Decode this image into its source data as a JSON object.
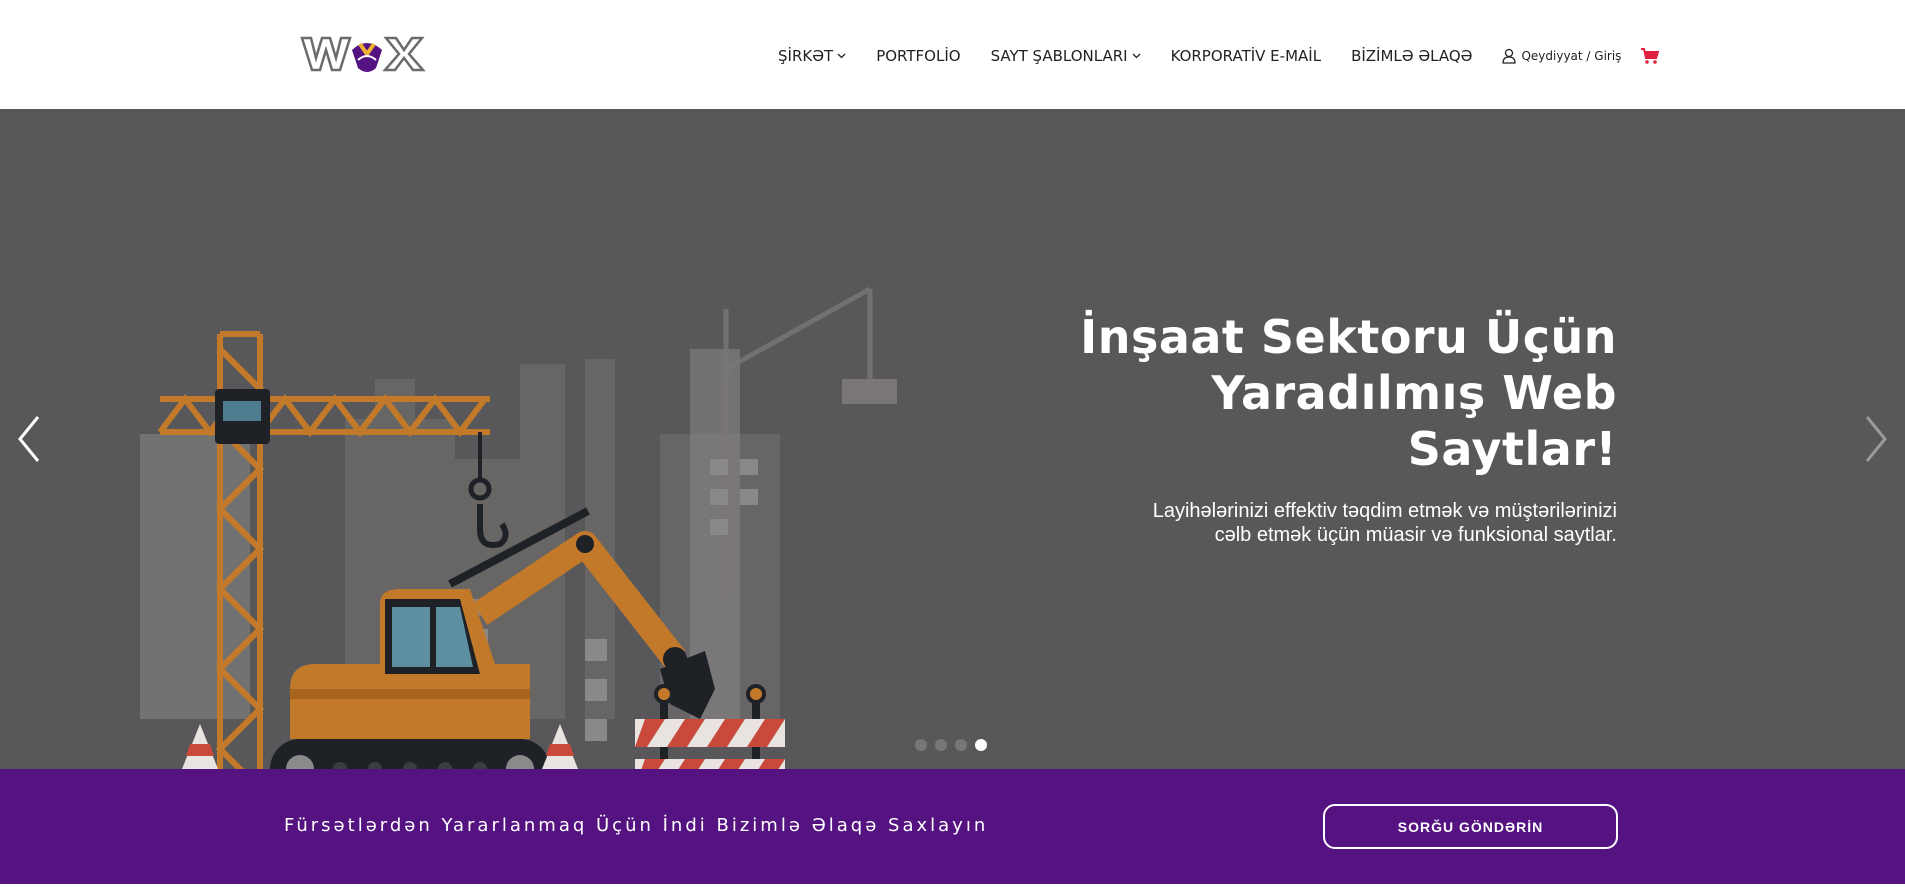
{
  "brand": {
    "logo_text": "WOX",
    "colors": {
      "purple": "#551382",
      "gray": "#58585a",
      "accent_red": "#e02040",
      "crane_orange": "#c27a2a"
    }
  },
  "nav": {
    "items": [
      {
        "label": "ŞİRKƏT",
        "has_dropdown": true
      },
      {
        "label": "PORTFOLİO",
        "has_dropdown": false
      },
      {
        "label": "SAYT ŞABLONLARI",
        "has_dropdown": true
      },
      {
        "label": "KORPORATİV E-MAİL",
        "has_dropdown": false
      },
      {
        "label": "BİZİMLƏ ƏLAQƏ",
        "has_dropdown": false
      }
    ],
    "login_label": "Qeydiyyat / Giriş",
    "login_icon": "user-icon",
    "cart_icon": "cart-icon"
  },
  "hero": {
    "title_lines": [
      "İnşaat Sektoru Üçün",
      "Yaradılmış Web",
      "Saytlar!"
    ],
    "subtitle_lines": [
      "Layihələrinizi effektiv təqdim etmək və müştərilərinizi",
      "cəlb etmək üçün müasir və funksional saytlar."
    ],
    "prev_icon": "chevron-left-icon",
    "next_icon": "chevron-right-icon",
    "slides_total": 4,
    "active_slide": 4
  },
  "cta": {
    "text": "Fürsətlərdən Yararlanmaq Üçün İndi Bizimlə Əlaqə Saxlayın",
    "button_label": "SORĞU GÖNDƏRİN"
  }
}
